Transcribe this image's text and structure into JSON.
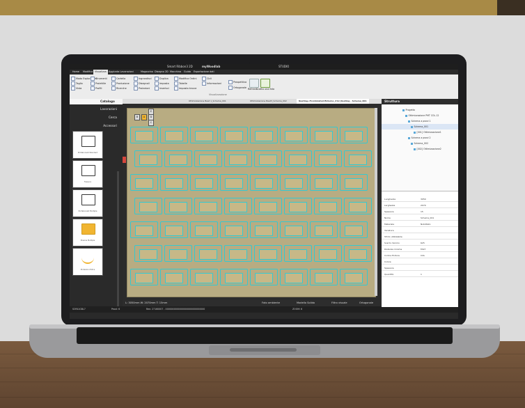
{
  "app": {
    "title_center": "STUDIO",
    "title_left": "Smart Ribbon3 2D",
    "title_doc": "myWoodlab"
  },
  "menu_tabs": [
    "Home",
    "Modifica",
    "Visualizza",
    "Aggiunta Lavorazioni",
    "Magazzino",
    "Disegno 2D",
    "Macchina",
    "Guida",
    "Esportazione dati"
  ],
  "ribbon": {
    "items": [
      "Modo Esploratore",
      "Taglio",
      "Vista",
      "Strumenti",
      "Proiettile",
      "Profili",
      "Cartella",
      "Produzione",
      "Ricerche",
      "Ingrandisci",
      "Disegnali",
      "Proiezioni",
      "Duplica",
      "Imposta",
      "Inserisci",
      "Modifica Ordini",
      "Tabelle",
      "Imposta tracce",
      "Cicli",
      "Informazioni",
      "Prospettiva",
      "Ortogonale"
    ],
    "group_label": "Visualizzazione",
    "right_label": "Scatta una foto",
    "refresh_label": "Refresh"
  },
  "catalog": {
    "header": "Catalogo",
    "sections": [
      "Lavorazioni",
      "Cerca",
      "Accessori"
    ],
    "cards": [
      "Portaborsati Standard",
      "Fessura",
      "Portaborsati Multiple",
      "Presina Multiple",
      "Protezioni Extra"
    ]
  },
  "doc_tabs": [
    "Ottimizzazione Baat 1_Schema_001",
    "Ottimizzazione Baat3_Schema_002",
    "Nesting+ForoVolatori/Esterno_#12_Nesting - Schema_001"
  ],
  "grid_rows": [
    "E",
    "D",
    "C"
  ],
  "grid_cells": [
    "B",
    "A"
  ],
  "status_bar": {
    "selection": "Foto ambiente",
    "dims": "L: 3050mm W: 2070mm T: 15mm",
    "mode": "Ortogonale",
    "filter": "Filtro visuale",
    "model": "Modello Solido"
  },
  "status_bar2": {
    "left": "SOFA1GBL7",
    "page": "Pezzi: 6",
    "code": "Ren: 27160007 - 0000000000000000000000000000",
    "zoom": "ZOOM: 6"
  },
  "structure": {
    "header": "Struttura",
    "rows": [
      "Progetto",
      "Ottimizzazione PMT COL.12",
      "Schema a pezzi 1",
      "Schema_001",
      "[001] Ottimizzazione1",
      "Schema a pezzi 2",
      "Schema_002",
      "[002] Ottimizzazione2"
    ]
  },
  "properties": {
    "rows": [
      {
        "l": "Lunghezza",
        "v": "3050"
      },
      {
        "l": "Larghezza",
        "v": "2070"
      },
      {
        "l": "Spessore",
        "v": "15"
      },
      {
        "l": "Nome",
        "v": "Schema_001"
      },
      {
        "l": "Materiale",
        "v": "Nobilitato"
      },
      {
        "l": "Venatura",
        "v": ""
      },
      {
        "l": "Sfrido utilizzabile",
        "v": ""
      },
      {
        "l": "Scarto minimo",
        "v": "625"
      },
      {
        "l": "Distanza minima",
        "v": "FAST"
      },
      {
        "l": "Codice finitura",
        "v": "COL"
      },
      {
        "l": "Colore",
        "v": ""
      },
      {
        "l": "Spessore",
        "v": ""
      },
      {
        "l": "Quantità",
        "v": "1"
      }
    ]
  },
  "colors": {
    "piece_outline": "#33c9d2",
    "sheet": "#b8ac82",
    "active_cell": "#f1b531",
    "marker": "#d5473d"
  }
}
